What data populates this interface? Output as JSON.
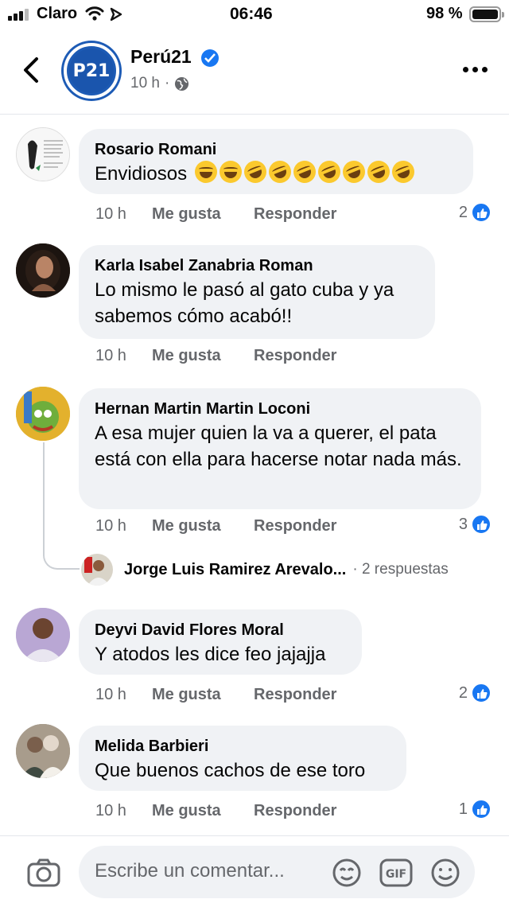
{
  "status_bar": {
    "carrier": "Claro",
    "time": "06:46",
    "battery": "98 %"
  },
  "header": {
    "page_name": "Perú21",
    "avatar_text": "P21",
    "post_time": "10 h",
    "post_time_sep": "·"
  },
  "comments": [
    {
      "author": "Rosario Romani",
      "text": "Envidiosos",
      "time": "10 h",
      "like_label": "Me gusta",
      "reply_label": "Responder",
      "likes": "2"
    },
    {
      "author": "Karla Isabel Zanabria Roman",
      "text": "Lo mismo le pasó al gato cuba y ya sabemos cómo acabó!!",
      "time": "10 h",
      "like_label": "Me gusta",
      "reply_label": "Responder",
      "likes": ""
    },
    {
      "author": "Hernan Martin Martin Loconi",
      "text": "A esa mujer quien la va a querer, el pata está con ella para hacerse notar nada más.",
      "time": "10 h",
      "like_label": "Me gusta",
      "reply_label": "Responder",
      "likes": "3"
    },
    {
      "author": "Deyvi David Flores Moral",
      "text": "Y atodos les dice feo jajajja",
      "time": "10 h",
      "like_label": "Me gusta",
      "reply_label": "Responder",
      "likes": "2"
    },
    {
      "author": "Melida Barbieri",
      "text": "Que buenos cachos de ese toro",
      "time": "10 h",
      "like_label": "Me gusta",
      "reply_label": "Responder",
      "likes": "1"
    }
  ],
  "reply_preview": {
    "author": "Jorge Luis Ramirez Arevalo...",
    "count": "· 2 respuestas"
  },
  "composer": {
    "placeholder": "Escribe un comentar..."
  }
}
